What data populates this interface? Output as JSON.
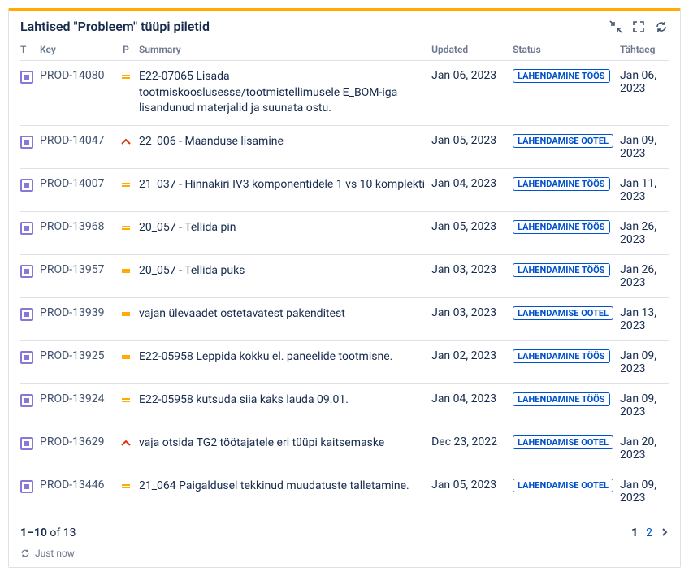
{
  "header": {
    "title": "Lahtised \"Probleem\" tüüpi piletid"
  },
  "columns": {
    "t": "T",
    "key": "Key",
    "p": "P",
    "summary": "Summary",
    "updated": "Updated",
    "status": "Status",
    "due": "Tähtaeg"
  },
  "rows": [
    {
      "key": "PROD-14080",
      "priority": "medium",
      "summary": "E22-07065 Lisada tootmiskooslusesse/tootmistellimusele E_BOM-iga lisandunud materjalid ja suunata ostu.",
      "updated": "Jan 06, 2023",
      "status": "LAHENDAMINE TÖÖS",
      "due": "Jan 06, 2023"
    },
    {
      "key": "PROD-14047",
      "priority": "high",
      "summary": "22_006 - Maanduse lisamine",
      "updated": "Jan 05, 2023",
      "status": "LAHENDAMISE OOTEL",
      "due": "Jan 09, 2023"
    },
    {
      "key": "PROD-14007",
      "priority": "medium",
      "summary": "21_037 - Hinnakiri IV3 komponentidele 1 vs 10 komplekti",
      "updated": "Jan 04, 2023",
      "status": "LAHENDAMINE TÖÖS",
      "due": "Jan 11, 2023"
    },
    {
      "key": "PROD-13968",
      "priority": "medium",
      "summary": "20_057 - Tellida pin",
      "updated": "Jan 05, 2023",
      "status": "LAHENDAMINE TÖÖS",
      "due": "Jan 26, 2023"
    },
    {
      "key": "PROD-13957",
      "priority": "medium",
      "summary": "20_057 - Tellida puks",
      "updated": "Jan 03, 2023",
      "status": "LAHENDAMINE TÖÖS",
      "due": "Jan 26, 2023"
    },
    {
      "key": "PROD-13939",
      "priority": "medium",
      "summary": "vajan ülevaadet ostetavatest pakenditest",
      "updated": "Jan 03, 2023",
      "status": "LAHENDAMISE OOTEL",
      "due": "Jan 13, 2023"
    },
    {
      "key": "PROD-13925",
      "priority": "medium",
      "summary": "E22-05958 Leppida kokku el. paneelide tootmisne.",
      "updated": "Jan 02, 2023",
      "status": "LAHENDAMINE TÖÖS",
      "due": "Jan 09, 2023"
    },
    {
      "key": "PROD-13924",
      "priority": "medium",
      "summary": "E22-05958 kutsuda siia kaks lauda 09.01.",
      "updated": "Jan 04, 2023",
      "status": "LAHENDAMINE TÖÖS",
      "due": "Jan 09, 2023"
    },
    {
      "key": "PROD-13629",
      "priority": "high",
      "summary": "vaja otsida TG2 töötajatele eri tüüpi kaitsemaske",
      "updated": "Dec 23, 2022",
      "status": "LAHENDAMISE OOTEL",
      "due": "Jan 20, 2023"
    },
    {
      "key": "PROD-13446",
      "priority": "medium",
      "summary": "21_064 Paigaldusel tekkinud muudatuste talletamine.",
      "updated": "Jan 05, 2023",
      "status": "LAHENDAMISE OOTEL",
      "due": "Jan 09, 2023"
    }
  ],
  "footer": {
    "range": "1–10",
    "of_label": "of",
    "total": "13",
    "refresh_label": "Just now"
  },
  "pager": {
    "current": "1",
    "next": "2"
  }
}
